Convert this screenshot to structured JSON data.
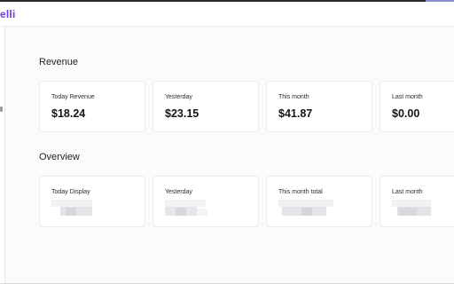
{
  "app": {
    "brand": "elli"
  },
  "revenue": {
    "title": "Revenue",
    "cards": [
      {
        "label": "Today Revenue",
        "value": "$18.24"
      },
      {
        "label": "Yesterday",
        "value": "$23.15"
      },
      {
        "label": "This month",
        "value": "$41.87"
      },
      {
        "label": "Last month",
        "value": "$0.00"
      }
    ]
  },
  "overview": {
    "title": "Overview",
    "cards": [
      {
        "label": "Today Display"
      },
      {
        "label": "Yesterday"
      },
      {
        "label": "This month total"
      },
      {
        "label": "Last month"
      }
    ]
  },
  "colors": {
    "brand": "#6a3fe0",
    "card_bg": "#ffffff",
    "page_bg": "#fbfbfc",
    "redacted_light": "#eeeef1",
    "redacted_dark": "#d9d9de"
  }
}
